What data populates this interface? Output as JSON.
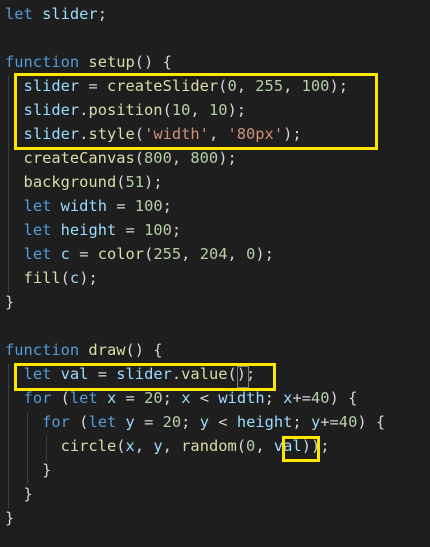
{
  "theme": {
    "background": "#1e1e1e",
    "keyword": "#569cd6",
    "function": "#dcdcaa",
    "variable": "#9cdcfe",
    "number": "#b5cea8",
    "string": "#ce9178",
    "operator": "#d4d4d4",
    "highlight": "#ffe600"
  },
  "code_lines": [
    [
      {
        "t": "let",
        "c": "kw"
      },
      {
        "t": " ",
        "c": "p"
      },
      {
        "t": "slider",
        "c": "var"
      },
      {
        "t": ";",
        "c": "p"
      }
    ],
    [],
    [
      {
        "t": "function",
        "c": "kw"
      },
      {
        "t": " ",
        "c": "p"
      },
      {
        "t": "setup",
        "c": "fn"
      },
      {
        "t": "() {",
        "c": "p"
      }
    ],
    [
      {
        "t": "  ",
        "c": "p"
      },
      {
        "t": "slider",
        "c": "var"
      },
      {
        "t": " = ",
        "c": "p"
      },
      {
        "t": "createSlider",
        "c": "fn"
      },
      {
        "t": "(",
        "c": "p"
      },
      {
        "t": "0",
        "c": "num"
      },
      {
        "t": ", ",
        "c": "p"
      },
      {
        "t": "255",
        "c": "num"
      },
      {
        "t": ", ",
        "c": "p"
      },
      {
        "t": "100",
        "c": "num"
      },
      {
        "t": ");",
        "c": "p"
      }
    ],
    [
      {
        "t": "  ",
        "c": "p"
      },
      {
        "t": "slider",
        "c": "var"
      },
      {
        "t": ".",
        "c": "p"
      },
      {
        "t": "position",
        "c": "fn"
      },
      {
        "t": "(",
        "c": "p"
      },
      {
        "t": "10",
        "c": "num"
      },
      {
        "t": ", ",
        "c": "p"
      },
      {
        "t": "10",
        "c": "num"
      },
      {
        "t": ");",
        "c": "p"
      }
    ],
    [
      {
        "t": "  ",
        "c": "p"
      },
      {
        "t": "slider",
        "c": "var"
      },
      {
        "t": ".",
        "c": "p"
      },
      {
        "t": "style",
        "c": "fn"
      },
      {
        "t": "(",
        "c": "p"
      },
      {
        "t": "'width'",
        "c": "str"
      },
      {
        "t": ", ",
        "c": "p"
      },
      {
        "t": "'80px'",
        "c": "str"
      },
      {
        "t": ");",
        "c": "p"
      }
    ],
    [
      {
        "t": "  ",
        "c": "p"
      },
      {
        "t": "createCanvas",
        "c": "fn"
      },
      {
        "t": "(",
        "c": "p"
      },
      {
        "t": "800",
        "c": "num"
      },
      {
        "t": ", ",
        "c": "p"
      },
      {
        "t": "800",
        "c": "num"
      },
      {
        "t": ");",
        "c": "p"
      }
    ],
    [
      {
        "t": "  ",
        "c": "p"
      },
      {
        "t": "background",
        "c": "fn"
      },
      {
        "t": "(",
        "c": "p"
      },
      {
        "t": "51",
        "c": "num"
      },
      {
        "t": ");",
        "c": "p"
      }
    ],
    [
      {
        "t": "  ",
        "c": "p"
      },
      {
        "t": "let",
        "c": "kw"
      },
      {
        "t": " ",
        "c": "p"
      },
      {
        "t": "width",
        "c": "var"
      },
      {
        "t": " = ",
        "c": "p"
      },
      {
        "t": "100",
        "c": "num"
      },
      {
        "t": ";",
        "c": "p"
      }
    ],
    [
      {
        "t": "  ",
        "c": "p"
      },
      {
        "t": "let",
        "c": "kw"
      },
      {
        "t": " ",
        "c": "p"
      },
      {
        "t": "height",
        "c": "var"
      },
      {
        "t": " = ",
        "c": "p"
      },
      {
        "t": "100",
        "c": "num"
      },
      {
        "t": ";",
        "c": "p"
      }
    ],
    [
      {
        "t": "  ",
        "c": "p"
      },
      {
        "t": "let",
        "c": "kw"
      },
      {
        "t": " ",
        "c": "p"
      },
      {
        "t": "c",
        "c": "var"
      },
      {
        "t": " = ",
        "c": "p"
      },
      {
        "t": "color",
        "c": "fn"
      },
      {
        "t": "(",
        "c": "p"
      },
      {
        "t": "255",
        "c": "num"
      },
      {
        "t": ", ",
        "c": "p"
      },
      {
        "t": "204",
        "c": "num"
      },
      {
        "t": ", ",
        "c": "p"
      },
      {
        "t": "0",
        "c": "num"
      },
      {
        "t": ");",
        "c": "p"
      }
    ],
    [
      {
        "t": "  ",
        "c": "p"
      },
      {
        "t": "fill",
        "c": "fn"
      },
      {
        "t": "(",
        "c": "p"
      },
      {
        "t": "c",
        "c": "var"
      },
      {
        "t": ");",
        "c": "p"
      }
    ],
    [
      {
        "t": "}",
        "c": "p"
      }
    ],
    [],
    [
      {
        "t": "function",
        "c": "kw"
      },
      {
        "t": " ",
        "c": "p"
      },
      {
        "t": "draw",
        "c": "fn"
      },
      {
        "t": "() {",
        "c": "p"
      }
    ],
    [
      {
        "t": "  ",
        "c": "p"
      },
      {
        "t": "let",
        "c": "kw"
      },
      {
        "t": " ",
        "c": "p"
      },
      {
        "t": "val",
        "c": "var"
      },
      {
        "t": " = ",
        "c": "p"
      },
      {
        "t": "slider",
        "c": "var"
      },
      {
        "t": ".",
        "c": "p"
      },
      {
        "t": "value",
        "c": "fn"
      },
      {
        "t": "();",
        "c": "p"
      }
    ],
    [
      {
        "t": "  ",
        "c": "p"
      },
      {
        "t": "for",
        "c": "kw"
      },
      {
        "t": " (",
        "c": "p"
      },
      {
        "t": "let",
        "c": "kw"
      },
      {
        "t": " ",
        "c": "p"
      },
      {
        "t": "x",
        "c": "var"
      },
      {
        "t": " = ",
        "c": "p"
      },
      {
        "t": "20",
        "c": "num"
      },
      {
        "t": "; ",
        "c": "p"
      },
      {
        "t": "x",
        "c": "var"
      },
      {
        "t": " < ",
        "c": "p"
      },
      {
        "t": "width",
        "c": "var"
      },
      {
        "t": "; ",
        "c": "p"
      },
      {
        "t": "x",
        "c": "var"
      },
      {
        "t": "+=",
        "c": "p"
      },
      {
        "t": "40",
        "c": "num"
      },
      {
        "t": ") {",
        "c": "p"
      }
    ],
    [
      {
        "t": "    ",
        "c": "p"
      },
      {
        "t": "for",
        "c": "kw"
      },
      {
        "t": " (",
        "c": "p"
      },
      {
        "t": "let",
        "c": "kw"
      },
      {
        "t": " ",
        "c": "p"
      },
      {
        "t": "y",
        "c": "var"
      },
      {
        "t": " = ",
        "c": "p"
      },
      {
        "t": "20",
        "c": "num"
      },
      {
        "t": "; ",
        "c": "p"
      },
      {
        "t": "y",
        "c": "var"
      },
      {
        "t": " < ",
        "c": "p"
      },
      {
        "t": "height",
        "c": "var"
      },
      {
        "t": "; ",
        "c": "p"
      },
      {
        "t": "y",
        "c": "var"
      },
      {
        "t": "+=",
        "c": "p"
      },
      {
        "t": "40",
        "c": "num"
      },
      {
        "t": ") {",
        "c": "p"
      }
    ],
    [
      {
        "t": "      ",
        "c": "p"
      },
      {
        "t": "circle",
        "c": "fn"
      },
      {
        "t": "(",
        "c": "p"
      },
      {
        "t": "x",
        "c": "var"
      },
      {
        "t": ", ",
        "c": "p"
      },
      {
        "t": "y",
        "c": "var"
      },
      {
        "t": ", ",
        "c": "p"
      },
      {
        "t": "random",
        "c": "fn"
      },
      {
        "t": "(",
        "c": "p"
      },
      {
        "t": "0",
        "c": "num"
      },
      {
        "t": ", ",
        "c": "p"
      },
      {
        "t": "val",
        "c": "var"
      },
      {
        "t": "));",
        "c": "p"
      }
    ],
    [
      {
        "t": "    }",
        "c": "p"
      }
    ],
    [
      {
        "t": "  }",
        "c": "p"
      }
    ],
    [
      {
        "t": "}",
        "c": "p"
      }
    ]
  ]
}
